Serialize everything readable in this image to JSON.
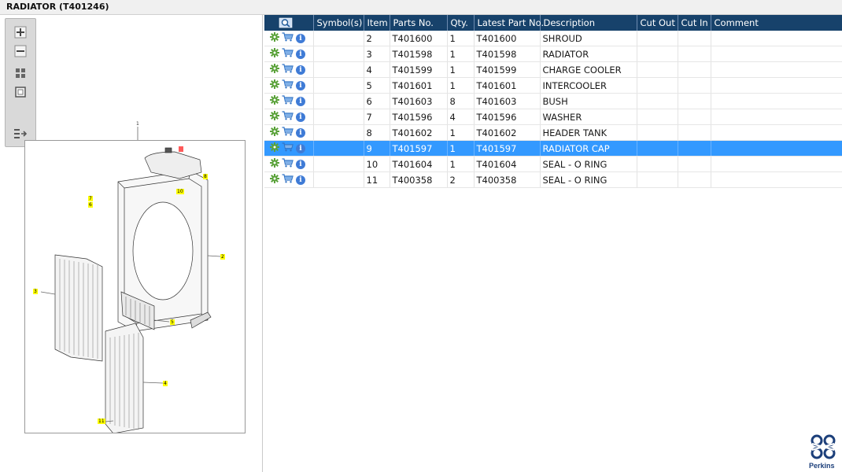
{
  "window": {
    "title": "RADIATOR (T401246)"
  },
  "toolbar": {
    "zoom_in_icon": "plus-icon",
    "zoom_out_icon": "minus-icon",
    "fit_icon": "fit-grid-icon",
    "actual_size_icon": "square-icon",
    "list_icon": "list-arrow-icon"
  },
  "drawing": {
    "callouts": [
      "1",
      "2",
      "3",
      "4",
      "5",
      "6",
      "7",
      "8",
      "9",
      "10",
      "11"
    ]
  },
  "table": {
    "columns": [
      "",
      "Symbol(s)",
      "Item",
      "Parts No.",
      "Qty.",
      "Latest Part No.",
      "Description",
      "Cut Out",
      "Cut In",
      "Comment"
    ],
    "rows": [
      {
        "symbols": "",
        "item": "2",
        "part_no": "T401600",
        "qty": "1",
        "latest": "T401600",
        "description": "SHROUD",
        "cut_out": "",
        "cut_in": "",
        "comment": ""
      },
      {
        "symbols": "",
        "item": "3",
        "part_no": "T401598",
        "qty": "1",
        "latest": "T401598",
        "description": "RADIATOR",
        "cut_out": "",
        "cut_in": "",
        "comment": ""
      },
      {
        "symbols": "",
        "item": "4",
        "part_no": "T401599",
        "qty": "1",
        "latest": "T401599",
        "description": "CHARGE COOLER",
        "cut_out": "",
        "cut_in": "",
        "comment": ""
      },
      {
        "symbols": "",
        "item": "5",
        "part_no": "T401601",
        "qty": "1",
        "latest": "T401601",
        "description": "INTERCOOLER",
        "cut_out": "",
        "cut_in": "",
        "comment": ""
      },
      {
        "symbols": "",
        "item": "6",
        "part_no": "T401603",
        "qty": "8",
        "latest": "T401603",
        "description": "BUSH",
        "cut_out": "",
        "cut_in": "",
        "comment": ""
      },
      {
        "symbols": "",
        "item": "7",
        "part_no": "T401596",
        "qty": "4",
        "latest": "T401596",
        "description": "WASHER",
        "cut_out": "",
        "cut_in": "",
        "comment": ""
      },
      {
        "symbols": "",
        "item": "8",
        "part_no": "T401602",
        "qty": "1",
        "latest": "T401602",
        "description": "HEADER TANK",
        "cut_out": "",
        "cut_in": "",
        "comment": ""
      },
      {
        "symbols": "",
        "item": "9",
        "part_no": "T401597",
        "qty": "1",
        "latest": "T401597",
        "description": "RADIATOR CAP",
        "cut_out": "",
        "cut_in": "",
        "comment": "",
        "selected": true
      },
      {
        "symbols": "",
        "item": "10",
        "part_no": "T401604",
        "qty": "1",
        "latest": "T401604",
        "description": "SEAL - O RING",
        "cut_out": "",
        "cut_in": "",
        "comment": ""
      },
      {
        "symbols": "",
        "item": "11",
        "part_no": "T400358",
        "qty": "2",
        "latest": "T400358",
        "description": "SEAL - O RING",
        "cut_out": "",
        "cut_in": "",
        "comment": ""
      }
    ],
    "row_icons": [
      "gear-icon",
      "cart-icon",
      "info-icon"
    ]
  },
  "logo": {
    "brand": "Perkins"
  },
  "colors": {
    "header_bg": "#17426b",
    "selected_row": "#3399ff",
    "callout_yellow": "#ffff00",
    "callout_red": "#ff5a5a",
    "brand_blue": "#1c3f7a"
  }
}
